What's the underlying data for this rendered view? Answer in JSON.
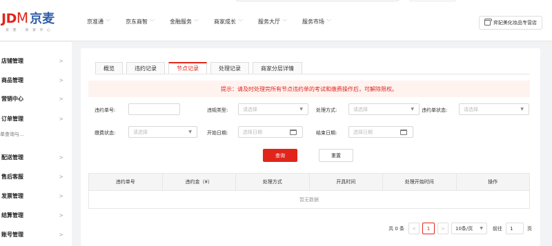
{
  "logo": {
    "brand": "JD",
    "m": "M",
    "cn": "京麦",
    "sub": "京 麦 · 商 家 中 心"
  },
  "nav": [
    {
      "label": "京准通"
    },
    {
      "label": "京东商智"
    },
    {
      "label": "金融服务"
    },
    {
      "label": "商家成长"
    },
    {
      "label": "服务大厅"
    },
    {
      "label": "服务市场"
    }
  ],
  "shop_name": "弈妃美化妆品专营店",
  "sidebar": {
    "items": [
      {
        "label": "店铺管理"
      },
      {
        "label": "商品管理"
      },
      {
        "label": "营销中心"
      },
      {
        "label": "订单管理"
      },
      {
        "label": "配送管理"
      },
      {
        "label": "售后客服"
      },
      {
        "label": "发票管理"
      },
      {
        "label": "结算管理"
      },
      {
        "label": "账号管理"
      }
    ],
    "sub_text": "单查询与..."
  },
  "tabs": [
    {
      "label": "概览"
    },
    {
      "label": "违约记录"
    },
    {
      "label": "节点记录",
      "active": true
    },
    {
      "label": "处理记录"
    },
    {
      "label": "商家分层详情"
    }
  ],
  "notice": "提示：请及时处理完所有节点违约单的考试和缴费操作后，可解除限权。",
  "filters": {
    "violation_no_label": "违约单号:",
    "violation_type_label": "违规类型:",
    "violation_type_placeholder": "请选择",
    "handle_method_label": "处理方式:",
    "handle_method_placeholder": "请选择",
    "order_status_label": "违约单状态:",
    "order_status_placeholder": "请选择",
    "pay_status_label": "缴费状态:",
    "pay_status_placeholder": "请选择",
    "start_date_label": "开始日期:",
    "start_date_placeholder": "选择日期",
    "end_date_label": "结束日期:",
    "end_date_placeholder": "选择日期"
  },
  "buttons": {
    "query": "查询",
    "reset": "重置"
  },
  "table": {
    "headers": [
      "违约单号",
      "违约金（¥）",
      "处理方式",
      "开具时间",
      "处理开始时间",
      "操作"
    ],
    "empty": "暂无数据"
  },
  "pagination": {
    "total": "共 0 条",
    "prev": "<",
    "current": "1",
    "next": ">",
    "page_size": "10条/页",
    "goto_label": "前往",
    "goto_value": "1",
    "page_unit": "页"
  },
  "colors": {
    "accent": "#e1251b",
    "brand_blue": "#2f5da8"
  }
}
